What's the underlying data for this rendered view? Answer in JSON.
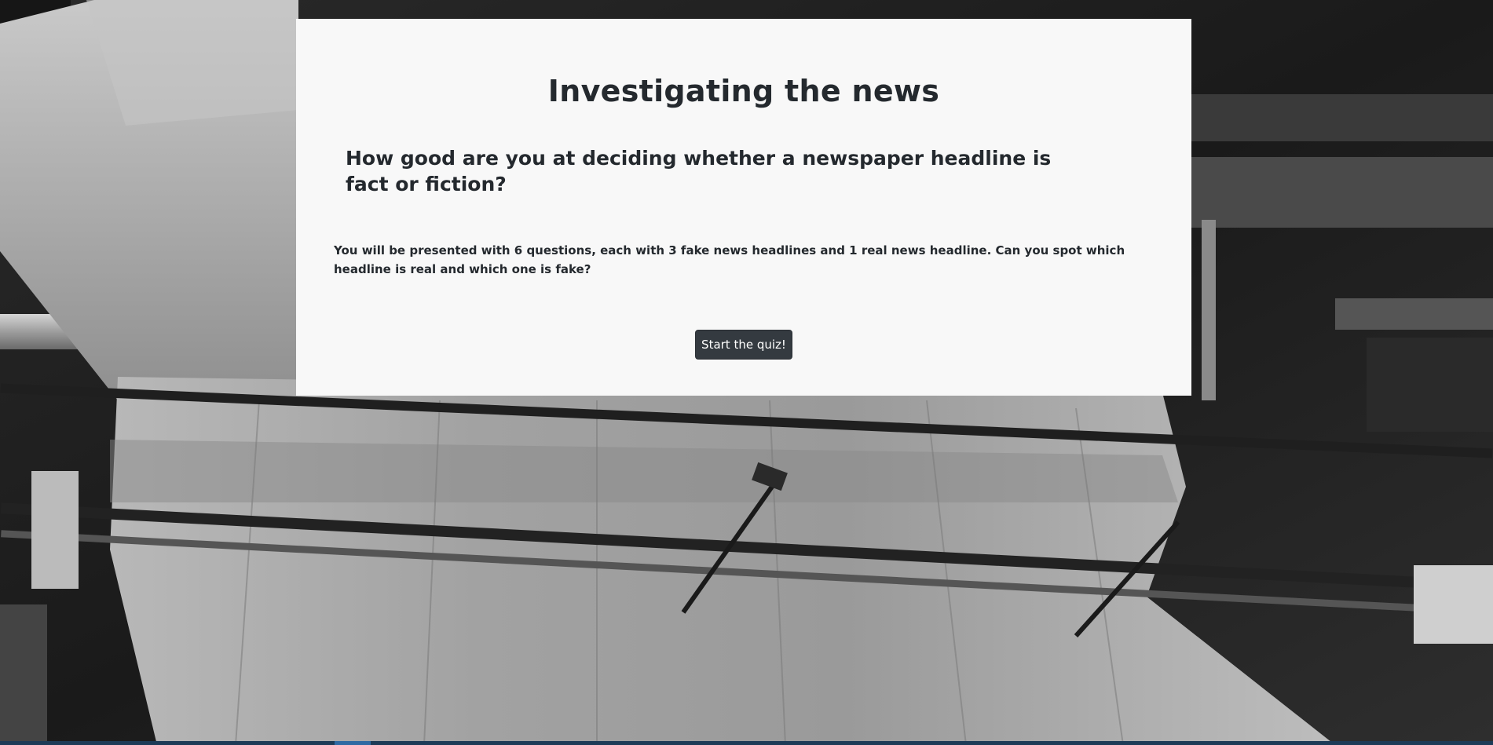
{
  "page": {
    "title": "Investigating the news",
    "subtitle": "How good are you at deciding whether a newspaper headline is fact or fiction?",
    "intro": "You will be presented with 6 questions, each with 3 fake news headlines and 1 real news headline. Can you spot which headline is real and which one is fake?",
    "start_button_label": "Start the quiz!"
  },
  "background": {
    "description_icon": "newspaper-press-photo-icon"
  },
  "colors": {
    "card_background": "#f8f8f8",
    "text": "#24292e",
    "button_background": "#343a40",
    "button_text": "#ffffff"
  }
}
